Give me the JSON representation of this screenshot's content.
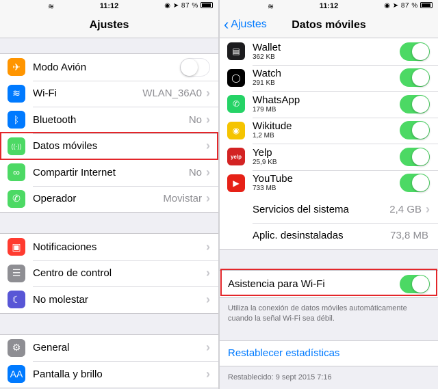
{
  "status": {
    "time": "11:12",
    "battery": "87 %"
  },
  "left": {
    "title": "Ajustes",
    "group1": [
      {
        "id": "modo-avion",
        "label": "Modo Avión",
        "icon": "airplane-icon",
        "glyph": "✈",
        "color": "#ff9500",
        "toggle": "off"
      },
      {
        "id": "wifi",
        "label": "Wi-Fi",
        "icon": "wifi-icon",
        "glyph": "≋",
        "color": "#007aff",
        "value": "WLAN_36A0"
      },
      {
        "id": "bluetooth",
        "label": "Bluetooth",
        "icon": "bluetooth-icon",
        "glyph": "ᛒ",
        "color": "#007aff",
        "value": "No"
      },
      {
        "id": "datos-moviles",
        "label": "Datos móviles",
        "icon": "cellular-antenna-icon",
        "glyph": "((·))",
        "color": "#4cd964",
        "value": ""
      },
      {
        "id": "compartir-internet",
        "label": "Compartir Internet",
        "icon": "hotspot-link-icon",
        "glyph": "∞",
        "color": "#4cd964",
        "value": "No"
      },
      {
        "id": "operador",
        "label": "Operador",
        "icon": "phone-icon",
        "glyph": "✆",
        "color": "#4cd964",
        "value": "Movistar"
      }
    ],
    "group2": [
      {
        "id": "notificaciones",
        "label": "Notificaciones",
        "icon": "notifications-icon",
        "glyph": "▣",
        "color": "#ff3b30"
      },
      {
        "id": "centro-de-control",
        "label": "Centro de control",
        "icon": "control-center-icon",
        "glyph": "☰",
        "color": "#8e8e93"
      },
      {
        "id": "no-molestar",
        "label": "No molestar",
        "icon": "moon-icon",
        "glyph": "☾",
        "color": "#5856d6"
      }
    ],
    "group3": [
      {
        "id": "general",
        "label": "General",
        "icon": "gear-icon",
        "glyph": "⚙",
        "color": "#8e8e93"
      },
      {
        "id": "pantalla-y-brillo",
        "label": "Pantalla y brillo",
        "icon": "display-brightness-icon",
        "glyph": "AA",
        "color": "#007aff"
      }
    ]
  },
  "right": {
    "title": "Datos móviles",
    "back_label": "Ajustes",
    "apps": [
      {
        "id": "wallet",
        "name": "Wallet",
        "size": "362 KB",
        "icon": "wallet-icon",
        "glyph": "▤",
        "color": "#1c1c1e"
      },
      {
        "id": "watch",
        "name": "Watch",
        "size": "291 KB",
        "icon": "watch-icon",
        "glyph": "◯",
        "color": "#000000"
      },
      {
        "id": "whatsapp",
        "name": "WhatsApp",
        "size": "179 MB",
        "icon": "whatsapp-icon",
        "glyph": "✆",
        "color": "#25d366"
      },
      {
        "id": "wikitude",
        "name": "Wikitude",
        "size": "1,2 MB",
        "icon": "wikitude-icon",
        "glyph": "◉",
        "color": "#f5c400"
      },
      {
        "id": "yelp",
        "name": "Yelp",
        "size": "25,9 KB",
        "icon": "yelp-icon",
        "glyph": "yelp",
        "color": "#d32323"
      },
      {
        "id": "youtube",
        "name": "YouTube",
        "size": "733 MB",
        "icon": "youtube-icon",
        "glyph": "▶",
        "color": "#e62117"
      }
    ],
    "system_services": {
      "label": "Servicios del sistema",
      "value": "2,4 GB"
    },
    "uninstalled": {
      "label": "Aplic. desinstaladas",
      "value": "73,8 MB"
    },
    "wifi_assist": {
      "label": "Asistencia para Wi-Fi",
      "toggle": "on"
    },
    "wifi_assist_note": "Utiliza la conexión de datos móviles automáticamente cuando la señal Wi-Fi sea débil.",
    "reset_stats": "Restablecer estadísticas",
    "reset_date": "Restablecido: 9 sept 2015 7:16"
  }
}
